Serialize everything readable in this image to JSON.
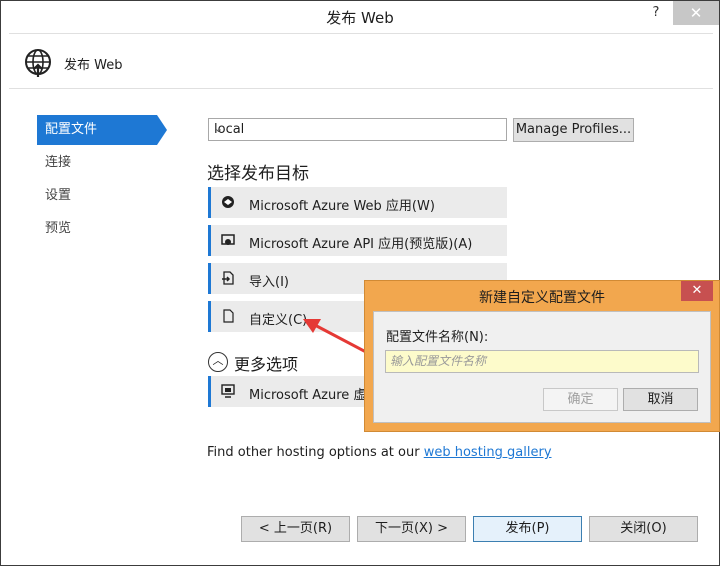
{
  "window": {
    "title": "发布 Web",
    "help": "?",
    "close": "✕"
  },
  "header": {
    "title": "发布 Web",
    "icon": "globe-publish-icon"
  },
  "nav": {
    "items": [
      {
        "label": "配置文件",
        "active": true
      },
      {
        "label": "连接",
        "active": false
      },
      {
        "label": "设置",
        "active": false
      },
      {
        "label": "预览",
        "active": false
      }
    ]
  },
  "profile": {
    "selected": "local",
    "manage_label": "Manage Profiles..."
  },
  "targets": {
    "heading": "选择发布目标",
    "items": [
      {
        "label": "Microsoft Azure Web 应用(W)",
        "icon": "azure-web-icon"
      },
      {
        "label": "Microsoft Azure API 应用(预览版)(A)",
        "icon": "azure-api-icon"
      },
      {
        "label": "导入(I)",
        "icon": "import-icon"
      },
      {
        "label": "自定义(C)",
        "icon": "file-icon"
      }
    ],
    "more_label": "更多选项",
    "more_items": [
      {
        "label": "Microsoft Azure 虚拟",
        "icon": "vm-icon"
      }
    ]
  },
  "hosting": {
    "text": "Find other hosting options at our ",
    "link": "web hosting gallery"
  },
  "footer": {
    "prev": "< 上一页(R)",
    "next": "下一页(X) >",
    "publish": "发布(P)",
    "close": "关闭(O)"
  },
  "dialog": {
    "title": "新建自定义配置文件",
    "label": "配置文件名称(N):",
    "placeholder": "输入配置文件名称",
    "ok": "确定",
    "cancel": "取消",
    "accent": "#f2a74e"
  }
}
